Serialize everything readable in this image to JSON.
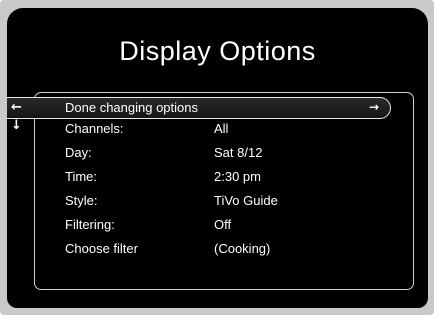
{
  "title": "Display Options",
  "done_option": {
    "label": "Done changing options",
    "left_icon": "left-arrow-icon",
    "right_icon": "right-arrow-circle-icon"
  },
  "options": [
    {
      "label": "Channels:",
      "value": "All"
    },
    {
      "label": "Day:",
      "value": "Sat 8/12"
    },
    {
      "label": "Time:",
      "value": "2:30 pm"
    },
    {
      "label": "Style:",
      "value": "TiVo Guide"
    },
    {
      "label": "Filtering:",
      "value": "Off"
    },
    {
      "label": "Choose filter",
      "value": "(Cooking)"
    }
  ],
  "colors": {
    "background": "#000000",
    "text": "#ffffff",
    "frame": "#c9c9c9"
  }
}
